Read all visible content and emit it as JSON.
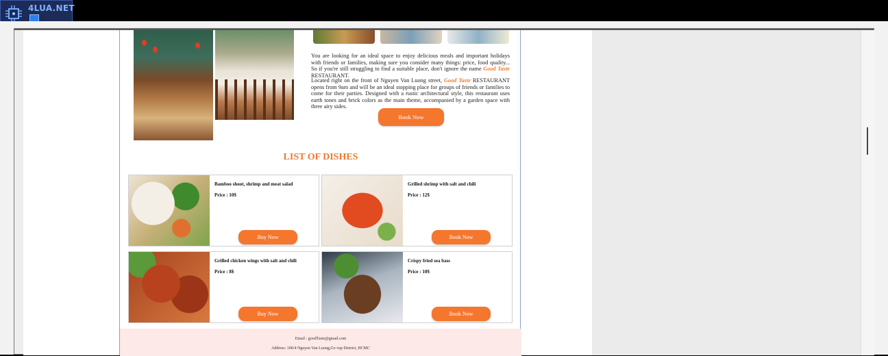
{
  "logo": {
    "text": "4LUA.NET"
  },
  "intro": {
    "para1_a": "You are looking for an ideal space to enjoy delicious meals and important holidays with friends or families, making sure you consider many things: price, food quality... So if you're still struggling to find a suitable place, don't ignore the name ",
    "brand": "Good Taste",
    "para1_b": " RESTAURANT.",
    "para2_a": "Located right on the front of Nguyen Van Luong street, ",
    "para2_b": " RESTAURANT opens from 9am and will be an ideal stopping place for groups of friends or families to come for their parties. Designed with a rustic architectural style, this restaurant uses earth tones and brick colors as the main theme, accompanied by a garden space with three airy sides.",
    "book_button": "Book Now"
  },
  "dishes": {
    "title": "LIST OF DISHES",
    "items": [
      {
        "name": "Bamboo shoot, shrimp and meat salad",
        "price": "Price : 10$",
        "button": "Buy Now"
      },
      {
        "name": "Grilled shrimp with salt and chili",
        "price": "Price : 12$",
        "button": "Book Now"
      },
      {
        "name": "Grilled chicken wings with salt and chili",
        "price": "Price : 8$",
        "button": "Buy Now"
      },
      {
        "name": "Crispy fried sea bass",
        "price": "Price : 10$",
        "button": "Book Now"
      }
    ]
  },
  "footer": {
    "email": "Email : goodTaste@gmail.com",
    "address": "Address: 100/4 Nguyen Van Luong,Go vap District, HCMC"
  }
}
